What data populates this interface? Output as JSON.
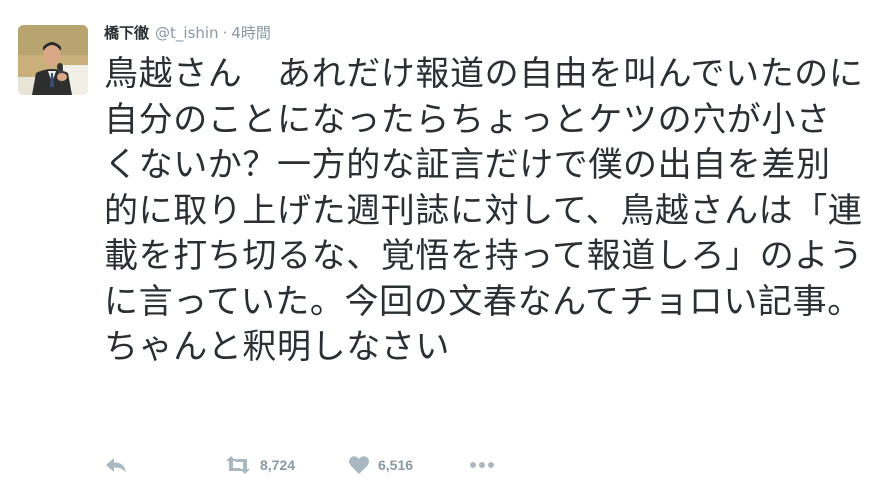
{
  "tweet": {
    "author_name": "橋下徹",
    "handle": "@t_ishin",
    "separator": "·",
    "time": "4時間",
    "text": "鳥越さん　あれだけ報道の自由を叫んでいたのに自分のことになったらちょっとケツの穴が小さくないか？一方的な証言だけで僕の出自を差別的に取り上げた週刊誌に対して、鳥越さんは「連載を打ち切るな、覚悟を持って報道しろ」のように言っていた。今回の文春なんてチョロい記事。ちゃんと釈明しなさい"
  },
  "actions": {
    "reply_icon": "reply-icon",
    "retweet_icon": "retweet-icon",
    "retweet_count": "8,724",
    "like_icon": "heart-icon",
    "like_count": "6,516",
    "more_icon": "more-dots-icon"
  },
  "colors": {
    "text": "#292f33",
    "muted": "#8899a6",
    "icon": "#aab8c2"
  }
}
